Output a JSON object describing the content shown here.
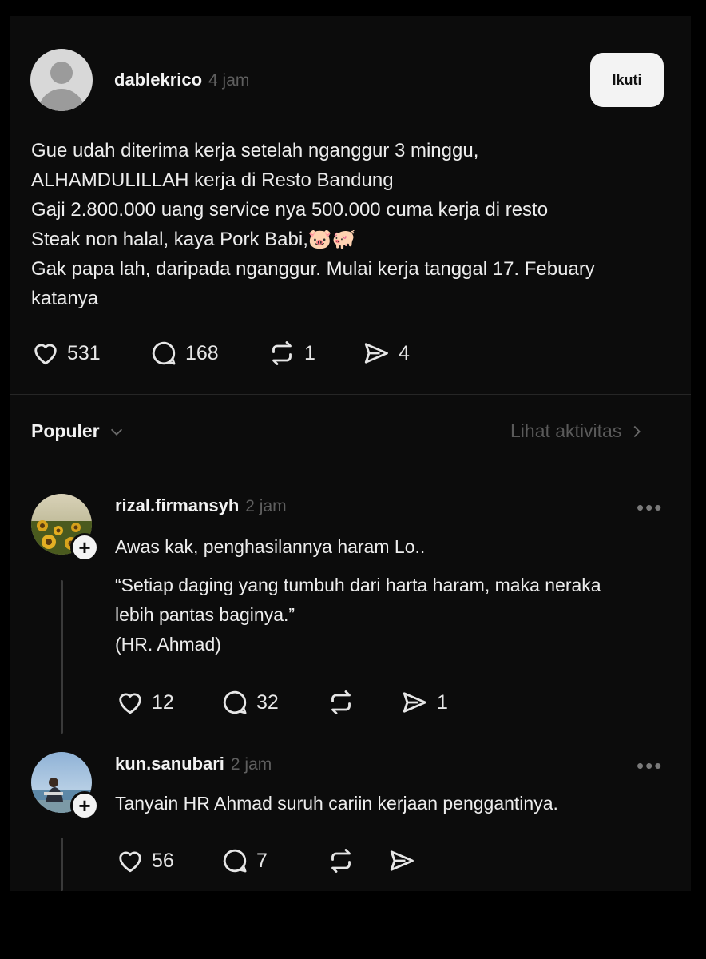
{
  "post": {
    "username": "dablekrico",
    "time": "4 jam",
    "follow_label": "Ikuti",
    "lines": [
      "Gue udah diterima kerja setelah nganggur 3 minggu,",
      "ALHAMDULILLAH kerja di Resto Bandung",
      "Gaji 2.800.000 uang service nya 500.000 cuma kerja di resto",
      "Steak non halal, kaya Pork Babi,🐷🐖",
      "Gak papa lah, daripada nganggur. Mulai kerja tanggal 17. Febuary",
      "katanya"
    ],
    "stats": {
      "likes": "531",
      "comments": "168",
      "reposts": "1",
      "shares": "4"
    }
  },
  "section": {
    "sort_label": "Populer",
    "activity_label": "Lihat aktivitas"
  },
  "replies": [
    {
      "username": "rizal.firmansyh",
      "time": "2 jam",
      "lines": [
        "Awas kak, penghasilannya haram Lo..",
        "“Setiap daging yang tumbuh dari harta haram, maka neraka",
        "lebih pantas baginya.”",
        "(HR. Ahmad)"
      ],
      "stats": {
        "likes": "12",
        "comments": "32",
        "reposts": "",
        "shares": "1"
      }
    },
    {
      "username": "kun.sanubari",
      "time": "2 jam",
      "lines": [
        "Tanyain HR Ahmad suruh cariin kerjaan penggantinya."
      ],
      "stats": {
        "likes": "56",
        "comments": "7",
        "reposts": "",
        "shares": ""
      }
    }
  ],
  "icons": {
    "like": "heart-icon",
    "comment": "comment-bubble-icon",
    "repost": "repost-icon",
    "share": "send-icon",
    "more": "more-dots-icon",
    "follow_plus": "plus-icon"
  }
}
